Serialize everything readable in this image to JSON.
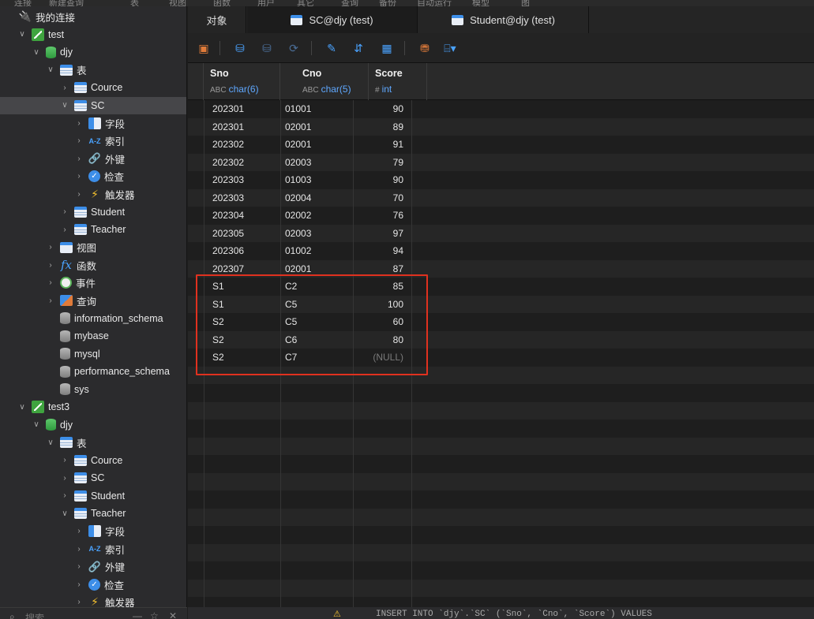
{
  "top_menu": [
    "连接",
    "新建查询",
    "表",
    "视图",
    "函数",
    "用户",
    "其它",
    "查询",
    "备份",
    "自动运行",
    "模型",
    "图"
  ],
  "sidebar": {
    "root_label": "我的连接",
    "connections": [
      {
        "name": "test",
        "databases": [
          {
            "name": "djy",
            "tables_label": "表",
            "tables": [
              "Cource",
              "SC",
              "Student",
              "Teacher"
            ],
            "selected_table": "SC",
            "subitems": [
              "字段",
              "索引",
              "外键",
              "检查",
              "触发器"
            ],
            "views_label": "视图",
            "functions_label": "函数",
            "events_label": "事件",
            "queries_label": "查询"
          }
        ],
        "other_databases": [
          "information_schema",
          "mybase",
          "mysql",
          "performance_schema",
          "sys"
        ]
      },
      {
        "name": "test3",
        "databases": [
          {
            "name": "djy",
            "tables_label": "表",
            "tables": [
              "Cource",
              "SC",
              "Student",
              "Teacher"
            ],
            "expanded_table": "Teacher",
            "subitems": [
              "字段",
              "索引",
              "外键",
              "检查",
              "触发器"
            ]
          }
        ]
      }
    ],
    "search_placeholder": "搜索"
  },
  "tabs": [
    {
      "label": "对象",
      "active": false
    },
    {
      "label": "SC@djy (test)",
      "active": true
    },
    {
      "label": "Student@djy (test)",
      "active": false
    }
  ],
  "grid": {
    "columns": [
      {
        "name": "Sno",
        "type_tag": "ABC",
        "type": "char(6)"
      },
      {
        "name": "Cno",
        "type_tag": "ABC",
        "type": "char(5)"
      },
      {
        "name": "Score",
        "type_tag": "#",
        "type": "int"
      }
    ],
    "rows": [
      [
        "202301",
        "01001",
        "90"
      ],
      [
        "202301",
        "02001",
        "89"
      ],
      [
        "202302",
        "02001",
        "91"
      ],
      [
        "202302",
        "02003",
        "79"
      ],
      [
        "202303",
        "01003",
        "90"
      ],
      [
        "202303",
        "02004",
        "70"
      ],
      [
        "202304",
        "02002",
        "76"
      ],
      [
        "202305",
        "02003",
        "97"
      ],
      [
        "202306",
        "01002",
        "94"
      ],
      [
        "202307",
        "02001",
        "87"
      ],
      [
        "S1",
        "C2",
        "85"
      ],
      [
        "S1",
        "C5",
        "100"
      ],
      [
        "S2",
        "C5",
        "60"
      ],
      [
        "S2",
        "C6",
        "80"
      ],
      [
        "S2",
        "C7",
        "(NULL)"
      ]
    ],
    "empty_rows": 14
  },
  "status": {
    "sql_preview": "INSERT INTO `djy`.`SC` (`Sno`, `Cno`, `Score`) VALUES"
  },
  "colors": {
    "accent": "#3d8ee8",
    "highlight_box": "#e0311f",
    "connection": "#3fa43f"
  }
}
